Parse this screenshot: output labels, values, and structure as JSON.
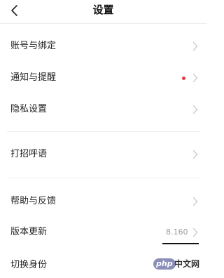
{
  "header": {
    "title": "设置",
    "back_icon": "chevron-left-icon"
  },
  "settings": {
    "account": {
      "label": "账号与绑定"
    },
    "notifications": {
      "label": "通知与提醒",
      "dot_color": "#e53949"
    },
    "privacy": {
      "label": "隐私设置"
    },
    "greeting": {
      "label": "打招呼语"
    },
    "help": {
      "label": "帮助与反馈"
    },
    "version": {
      "label": "版本更新",
      "value": "8.160"
    },
    "switch_identity": {
      "label": "切换身份"
    }
  },
  "watermark": {
    "logo_text": "php",
    "site_text": "中文网"
  }
}
